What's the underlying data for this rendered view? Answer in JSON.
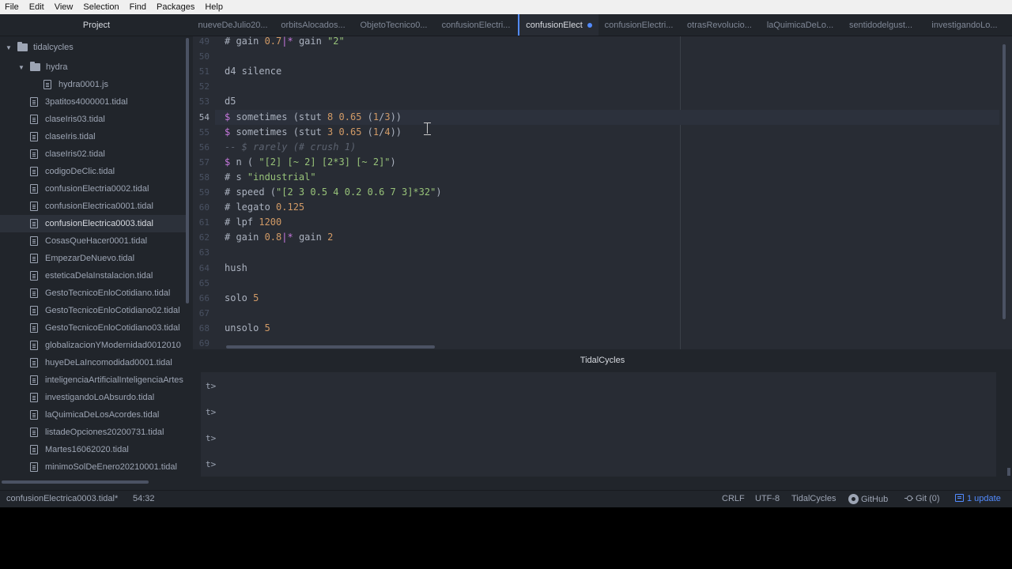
{
  "menu": [
    "File",
    "Edit",
    "View",
    "Selection",
    "Find",
    "Packages",
    "Help"
  ],
  "tree": {
    "title": "Project",
    "root": "tidalcycles",
    "subfolder": "hydra",
    "subfolder_file": "hydra0001.js",
    "files": [
      "3patitos4000001.tidal",
      "claseIris03.tidal",
      "claseIris.tidal",
      "claseIris02.tidal",
      "codigoDeClic.tidal",
      "confusionElectria0002.tidal",
      "confusionElectrica0001.tidal",
      "confusionElectrica0003.tidal",
      "CosasQueHacer0001.tidal",
      "EmpezarDeNuevo.tidal",
      "esteticaDelaInstalacion.tidal",
      "GestoTecnicoEnloCotidiano.tidal",
      "GestoTecnicoEnloCotidiano02.tidal",
      "GestoTecnicoEnloCotidiano03.tidal",
      "globalizacionYModernidad0012010",
      "huyeDeLaIncomodidad0001.tidal",
      "inteligenciaArtificialInteligenciaArtes",
      "investigandoLoAbsurdo.tidal",
      "laQuimicaDeLosAcordes.tidal",
      "listadeOpciones20200731.tidal",
      "Martes16062020.tidal",
      "minimoSolDeEnero20210001.tidal"
    ],
    "selected_file": "confusionElectrica0003.tidal"
  },
  "tabs": [
    "nueveDeJulio20...",
    "orbitsAlocados...",
    "ObjetoTecnico0...",
    "confusionElectri...",
    "confusionElect",
    "confusionElectri...",
    "otrasRevolucio...",
    "laQuimicaDeLo...",
    "sentidodelgust...",
    "investigandoLo..."
  ],
  "active_tab_index": 4,
  "editor": {
    "line_numbers": [
      "49",
      "50",
      "51",
      "52",
      "53",
      "54",
      "55",
      "56",
      "57",
      "58",
      "59",
      "60",
      "61",
      "62",
      "63",
      "64",
      "65",
      "66",
      "67",
      "68",
      "69"
    ],
    "current_line": "54",
    "lines": {
      "l49": [
        "# gain ",
        "0.7",
        "|* ",
        "gain ",
        "\"2\""
      ],
      "l51": [
        "d4 silence"
      ],
      "l53": [
        "d5"
      ],
      "l54": [
        "$ ",
        "sometimes (stut ",
        "8",
        " ",
        "0.65",
        " (",
        "1",
        "/",
        "3",
        "))"
      ],
      "l55": [
        "$ ",
        "sometimes (stut ",
        "3",
        " ",
        "0.65",
        " (",
        "1",
        "/",
        "4",
        "))"
      ],
      "l56": [
        "-- $ rarely (# crush 1)"
      ],
      "l57": [
        "$ ",
        "n ( ",
        "\"[2] [~ 2] [2*3] [~ 2]\"",
        ")"
      ],
      "l58": [
        "# s ",
        "\"industrial\""
      ],
      "l59": [
        "# speed (",
        "\"[2 3 0.5 4 0.2 0.6 7 3]*32\"",
        ")"
      ],
      "l60": [
        "# legato ",
        "0.125"
      ],
      "l61": [
        "# lpf ",
        "1200"
      ],
      "l62": [
        "# gain ",
        "0.8",
        "|* ",
        "gain ",
        "2"
      ],
      "l64": [
        "hush"
      ],
      "l66": [
        "solo ",
        "5"
      ],
      "l68": [
        "unsolo ",
        "5"
      ]
    }
  },
  "tidal_panel": {
    "title": "TidalCycles",
    "prompts": [
      "t>",
      "t>",
      "t>",
      "t>"
    ]
  },
  "status": {
    "file": "confusionElectrica0003.tidal*",
    "cursor": "54:32",
    "line_ending": "CRLF",
    "encoding": "UTF-8",
    "grammar": "TidalCycles",
    "github": "GitHub",
    "git": "Git (0)",
    "update": "1 update"
  },
  "colors": {
    "accent": "#528bff",
    "number": "#d19a66",
    "string": "#98c379",
    "operator": "#c678dd",
    "comment": "#5c6370"
  }
}
